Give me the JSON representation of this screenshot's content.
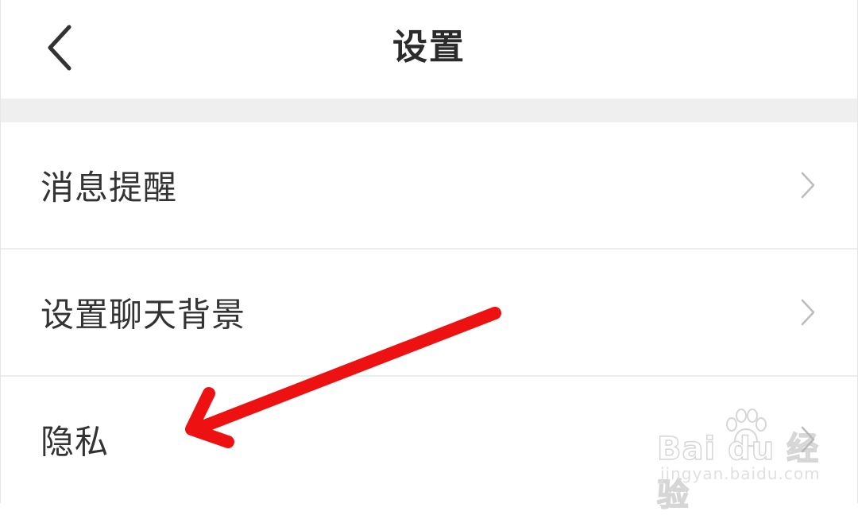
{
  "header": {
    "title": "设置",
    "back_icon": "chevron-left-icon"
  },
  "settings": {
    "items": [
      {
        "label": "消息提醒",
        "icon": "chevron-right-icon"
      },
      {
        "label": "设置聊天背景",
        "icon": "chevron-right-icon"
      },
      {
        "label": "隐私",
        "icon": "chevron-right-icon"
      }
    ]
  },
  "annotation": {
    "type": "arrow",
    "color": "#ee1111",
    "points_to": "隐私"
  },
  "watermark": {
    "brand": "Bai du 经验",
    "url": "jingyan.baidu.com"
  },
  "colors": {
    "background": "#ffffff",
    "gap_band": "#efefef",
    "divider": "#eeeeee",
    "text": "#333333",
    "chevron": "#bbbbbb"
  }
}
